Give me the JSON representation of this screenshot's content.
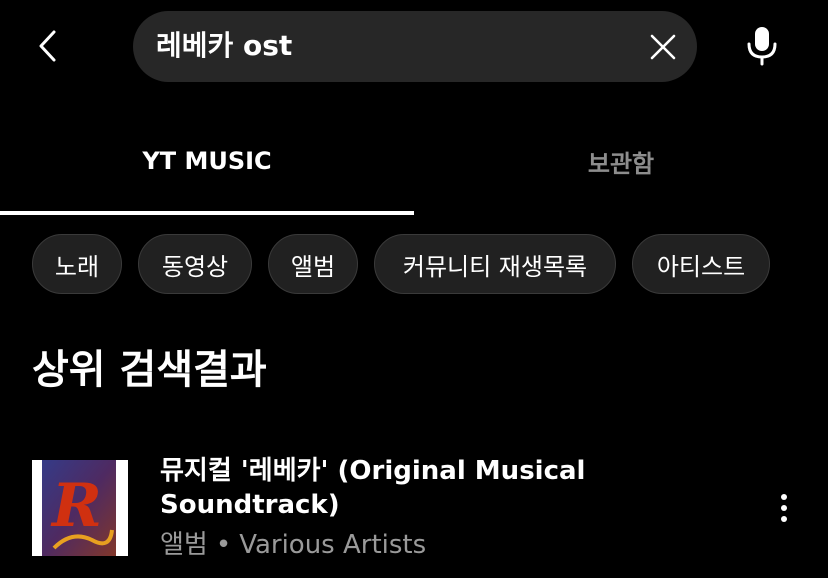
{
  "header": {
    "search_value": "레베카 ost",
    "icons": {
      "back": "chevron-left-icon",
      "clear": "close-icon",
      "mic": "microphone-icon"
    }
  },
  "tabs": [
    {
      "label": "YT MUSIC",
      "active": true
    },
    {
      "label": "보관함",
      "active": false
    }
  ],
  "chips": [
    {
      "label": "노래"
    },
    {
      "label": "동영상"
    },
    {
      "label": "앨범"
    },
    {
      "label": "커뮤니티 재생목록"
    },
    {
      "label": "아티스트"
    }
  ],
  "section": {
    "title": "상위 검색결과"
  },
  "top_result": {
    "title": "뮤지컬 '레베카' (Original Musical Soundtrack)",
    "type": "앨범",
    "separator": "•",
    "artist": "Various Artists",
    "thumbnail_letter": "R"
  },
  "colors": {
    "background": "#000000",
    "search_bg": "#272727",
    "chip_bg": "#212121",
    "inactive_tab": "#8d8d8d",
    "secondary_text": "#9a9a9a"
  }
}
